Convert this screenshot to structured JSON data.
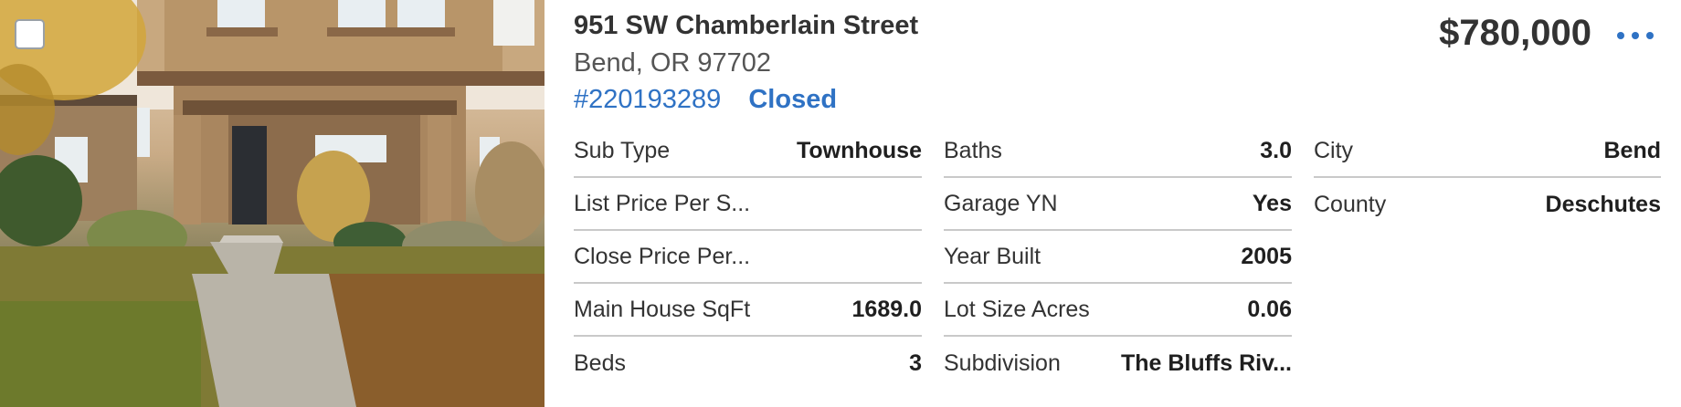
{
  "listing": {
    "address": "951 SW Chamberlain Street",
    "city_state_zip": "Bend, OR 97702",
    "mls_number": "#220193289",
    "status": "Closed",
    "price": "$780,000",
    "more_icon": "more-horizontal-icon",
    "photo_alt": "Townhouse front exterior"
  },
  "details": {
    "col1": [
      {
        "label": "Sub Type",
        "value": "Townhouse"
      },
      {
        "label": "List Price Per S...",
        "value": ""
      },
      {
        "label": "Close Price Per...",
        "value": ""
      },
      {
        "label": "Main House SqFt",
        "value": "1689.0"
      },
      {
        "label": "Beds",
        "value": "3"
      }
    ],
    "col2": [
      {
        "label": "Baths",
        "value": "3.0"
      },
      {
        "label": "Garage YN",
        "value": "Yes"
      },
      {
        "label": "Year Built",
        "value": "2005"
      },
      {
        "label": "Lot Size Acres",
        "value": "0.06"
      },
      {
        "label": "Subdivision",
        "value": "The Bluffs Riv..."
      }
    ],
    "col3": [
      {
        "label": "City",
        "value": "Bend"
      },
      {
        "label": "County",
        "value": "Deschutes"
      }
    ]
  },
  "colors": {
    "accent": "#2f72c4",
    "text": "#333333",
    "divider": "#c9c9c9"
  }
}
